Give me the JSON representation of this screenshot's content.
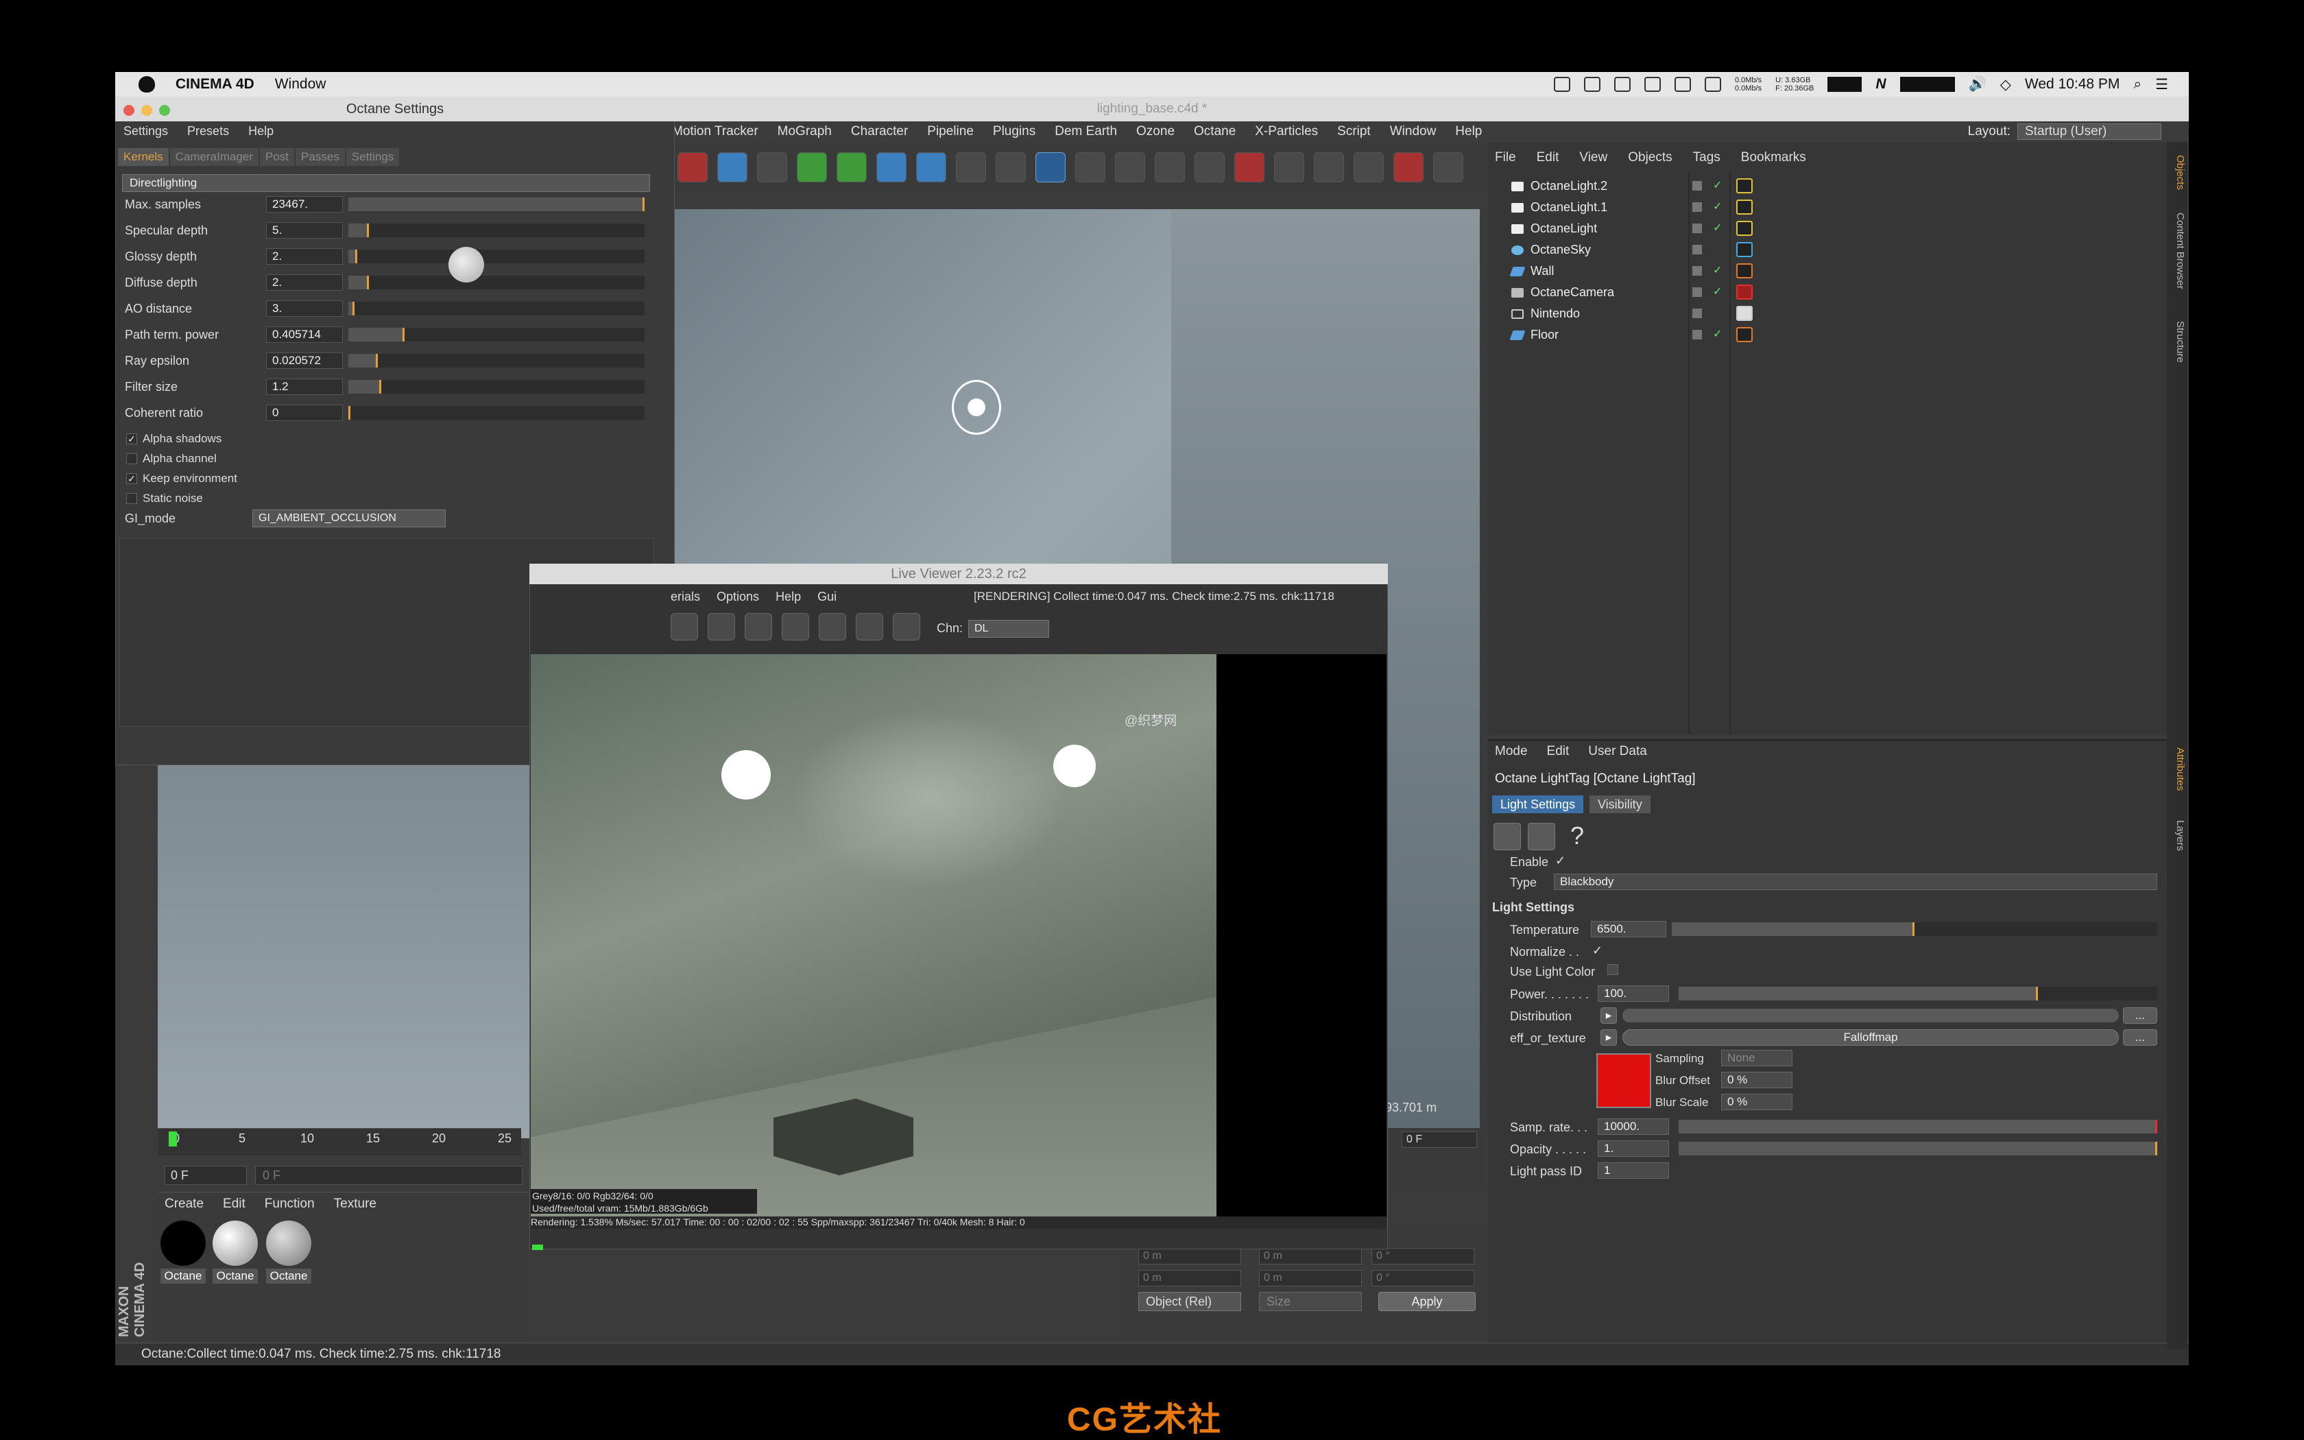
{
  "menubar": {
    "app_name": "CINEMA 4D",
    "window_menu": "Window",
    "clock": "Wed 10:48 PM",
    "net_stats": "0.0Mb/s\n0.0Mb/s",
    "mem_stats": "U: 3.63GB\nF: 20.36GB",
    "n_label": "N"
  },
  "window_title": "lighting_base.c4d *",
  "main_menu": [
    "Motion Tracker",
    "MoGraph",
    "Character",
    "Pipeline",
    "Plugins",
    "Dem Earth",
    "Ozone",
    "Octane",
    "X-Particles",
    "Script",
    "Window",
    "Help"
  ],
  "layout": {
    "label": "Layout:",
    "value": "Startup (User)"
  },
  "octane_settings": {
    "title": "Octane Settings",
    "menu": [
      "Settings",
      "Presets",
      "Help"
    ],
    "tabs": [
      "Kernels",
      "CameraImager",
      "Post",
      "Passes",
      "Settings"
    ],
    "kernel": "Directlighting",
    "params": [
      {
        "label": "Max. samples",
        "value": "23467.",
        "fill": 1.0
      },
      {
        "label": "Specular depth",
        "value": "5.",
        "fill": 0.07
      },
      {
        "label": "Glossy depth",
        "value": "2.",
        "fill": 0.03
      },
      {
        "label": "Diffuse depth",
        "value": "2.",
        "fill": 0.07
      },
      {
        "label": "AO distance",
        "value": "3.",
        "fill": 0.02
      },
      {
        "label": "Path term. power",
        "value": "0.405714",
        "fill": 0.19
      },
      {
        "label": "Ray epsilon",
        "value": "0.020572",
        "fill": 0.1
      },
      {
        "label": "Filter size",
        "value": "1.2",
        "fill": 0.11
      },
      {
        "label": "Coherent ratio",
        "value": "0",
        "fill": 0.0
      }
    ],
    "checks": [
      {
        "label": "Alpha shadows",
        "on": true
      },
      {
        "label": "Alpha channel",
        "on": false
      },
      {
        "label": "Keep environment",
        "on": true
      },
      {
        "label": "Static noise",
        "on": false
      }
    ],
    "gi_mode_label": "GI_mode",
    "gi_mode_value": "GI_AMBIENT_OCCLUSION"
  },
  "live_viewer": {
    "title": "Live Viewer 2.23.2 rc2",
    "menu": [
      "erials",
      "Options",
      "Help",
      "Gui"
    ],
    "status": "[RENDERING] Collect time:0.047 ms.  Check time:2.75 ms.  chk:11718",
    "chn_label": "Chn:",
    "chn_value": "DL",
    "stats_line1": "Grey8/16: 0/0     Rgb32/64: 0/0",
    "stats_line2": "Used/free/total vram: 15Mb/1.883Gb/6Gb",
    "stats_line3": "Rendering: 1.538%   Ms/sec: 57.017   Time: 00 : 00 : 02/00 : 02 : 55   Spp/maxspp: 361/23467      Tri: 0/40k      Mesh: 8      Hair: 0",
    "watermark": "@织梦网"
  },
  "objects": {
    "menu": [
      "File",
      "Edit",
      "View",
      "Objects",
      "Tags",
      "Bookmarks"
    ],
    "items": [
      {
        "name": "OctaneLight.2",
        "icon": "light-icon"
      },
      {
        "name": "OctaneLight.1",
        "icon": "light-icon"
      },
      {
        "name": "OctaneLight",
        "icon": "light-icon"
      },
      {
        "name": "OctaneSky",
        "icon": "sky-icon"
      },
      {
        "name": "Wall",
        "icon": "polygon-icon"
      },
      {
        "name": "OctaneCamera",
        "icon": "camera-icon"
      },
      {
        "name": "Nintendo",
        "icon": "null-icon"
      },
      {
        "name": "Floor",
        "icon": "polygon-icon"
      }
    ]
  },
  "attributes": {
    "menu": [
      "Mode",
      "Edit",
      "User Data"
    ],
    "title": "Octane LightTag [Octane LightTag]",
    "tabs": [
      "Light Settings",
      "Visibility"
    ],
    "enable_label": "Enable",
    "type_label": "Type",
    "type_value": "Blackbody",
    "section": "Light Settings",
    "temperature_label": "Temperature",
    "temperature_value": "6500.",
    "temperature_fill": 0.5,
    "normalize_label": "Normalize . .",
    "use_light_color_label": "Use Light Color",
    "power_label": "Power. . . . . . .",
    "power_value": "100.",
    "power_fill": 0.75,
    "distribution_label": "Distribution",
    "eff_label": "eff_or_texture",
    "eff_value": "Falloffmap",
    "sampling_label": "Sampling",
    "sampling_value": "None",
    "blur_offset_label": "Blur Offset",
    "blur_offset_value": "0 %",
    "blur_scale_label": "Blur Scale",
    "blur_scale_value": "0 %",
    "samp_rate_label": "Samp. rate. . .",
    "samp_rate_value": "10000.",
    "opacity_label": "Opacity . . . . .",
    "opacity_value": "1.",
    "light_pass_label": "Light pass ID",
    "light_pass_value": "1",
    "more_btn": "...",
    "red_color": "#e01010"
  },
  "side_tabs": [
    "Objects",
    "Content Browser",
    "Structure",
    "Attributes",
    "Layers"
  ],
  "timeline": {
    "ticks": [
      "0",
      "5",
      "10",
      "15",
      "20",
      "25"
    ],
    "frame": "0 F",
    "frame2": "0 F",
    "frame3": "0 F"
  },
  "viewport_readout": "393.701 m",
  "materials": {
    "menu": [
      "Create",
      "Edit",
      "Function",
      "Texture"
    ],
    "labels": [
      "Octane",
      "Octane",
      "Octane"
    ]
  },
  "coords": {
    "x1": "0 m",
    "y1": "0 m",
    "p1": "0 °",
    "x2": "0 m",
    "z2": "0 m",
    "b2": "0 °",
    "mode": "Object (Rel)",
    "size": "Size",
    "apply": "Apply"
  },
  "maxon": "MAXON CINEMA 4D",
  "statusbar": "Octane:Collect time:0.047 ms.  Check time:2.75 ms.  chk:11718",
  "footer_logo": "CG艺术社"
}
